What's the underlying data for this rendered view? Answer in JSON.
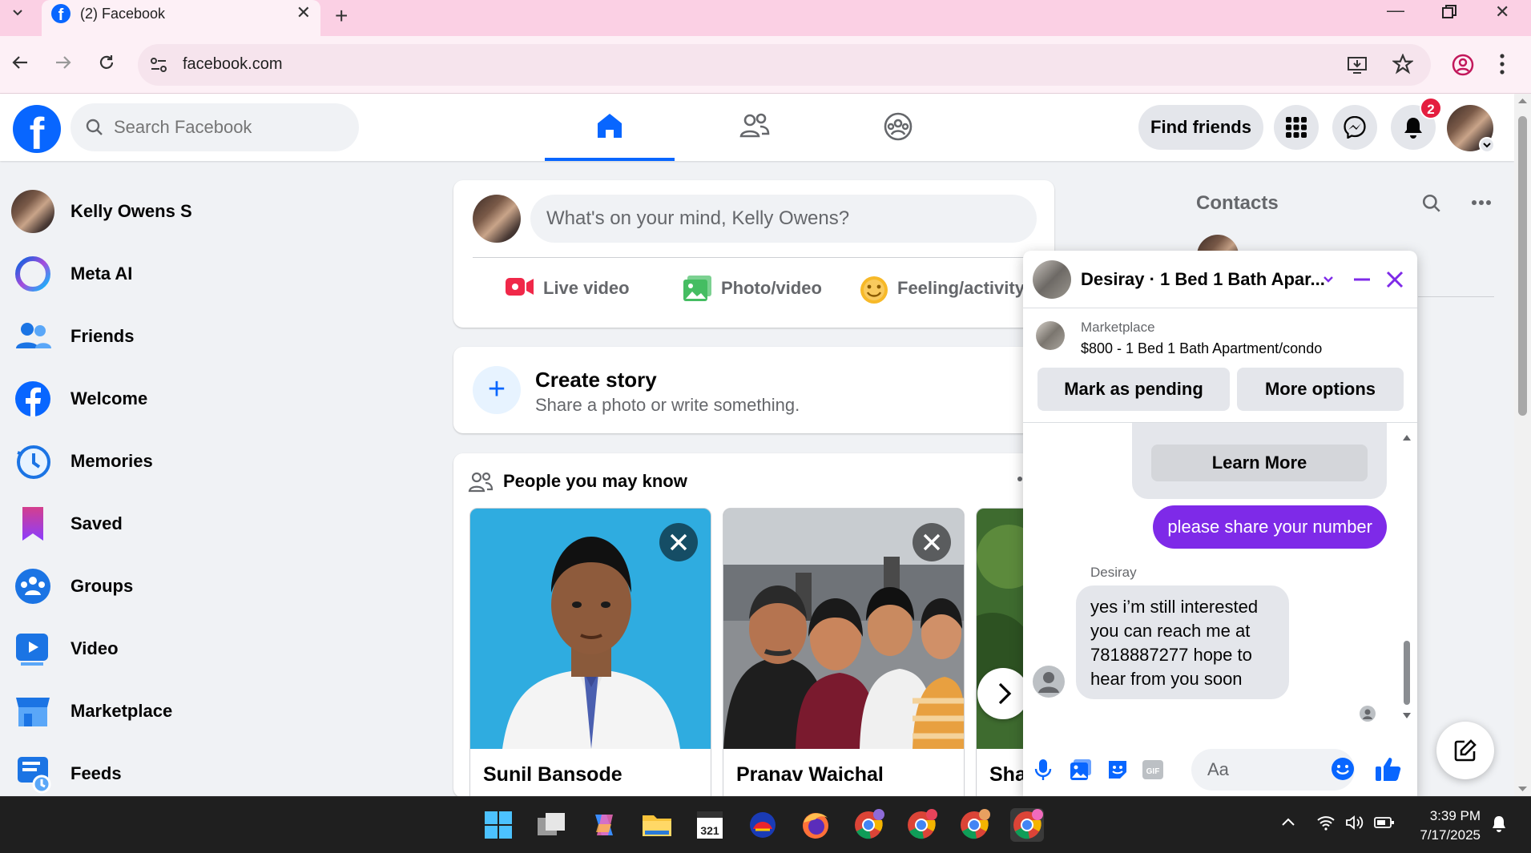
{
  "browser": {
    "tab_title": "(2) Facebook",
    "url": "facebook.com"
  },
  "header": {
    "search_placeholder": "Search Facebook",
    "find_friends": "Find friends",
    "notification_count": "2"
  },
  "sidebar": {
    "items": [
      {
        "label": "Kelly Owens S",
        "icon": "profile-avatar"
      },
      {
        "label": "Meta AI",
        "icon": "meta-ai-icon"
      },
      {
        "label": "Friends",
        "icon": "friends-icon"
      },
      {
        "label": "Welcome",
        "icon": "facebook-icon"
      },
      {
        "label": "Memories",
        "icon": "clock-icon"
      },
      {
        "label": "Saved",
        "icon": "bookmark-icon"
      },
      {
        "label": "Groups",
        "icon": "groups-icon"
      },
      {
        "label": "Video",
        "icon": "video-icon"
      },
      {
        "label": "Marketplace",
        "icon": "store-icon"
      },
      {
        "label": "Feeds",
        "icon": "feeds-icon"
      }
    ]
  },
  "composer": {
    "placeholder": "What's on your mind, Kelly Owens?",
    "live_video": "Live video",
    "photo_video": "Photo/video",
    "feeling": "Feeling/activity"
  },
  "story": {
    "title": "Create story",
    "subtitle": "Share a photo or write something."
  },
  "pymk": {
    "title": "People you may know",
    "people": [
      {
        "name": "Sunil Bansode"
      },
      {
        "name": "Pranav Waichal"
      },
      {
        "name": "Sha"
      }
    ]
  },
  "contacts": {
    "title": "Contacts"
  },
  "chat": {
    "title": "Desiray · 1 Bed 1 Bath Apar...",
    "listing_category": "Marketplace",
    "listing_desc": "$800 - 1 Bed 1 Bath Apartment/condo",
    "mark_pending": "Mark as pending",
    "more_options": "More options",
    "learn_more": "Learn More",
    "outgoing": "please share your number",
    "sender": "Desiray",
    "incoming": "yes i’m still interested you can reach me at 7818887277 hope to hear from you soon",
    "input_placeholder": "Aa"
  },
  "taskbar": {
    "time": "3:39 PM",
    "date": "7/17/2025"
  },
  "colors": {
    "fb_blue": "#0866ff",
    "messenger_purple": "#7e2ae8",
    "notification_red": "#e41e3f"
  }
}
